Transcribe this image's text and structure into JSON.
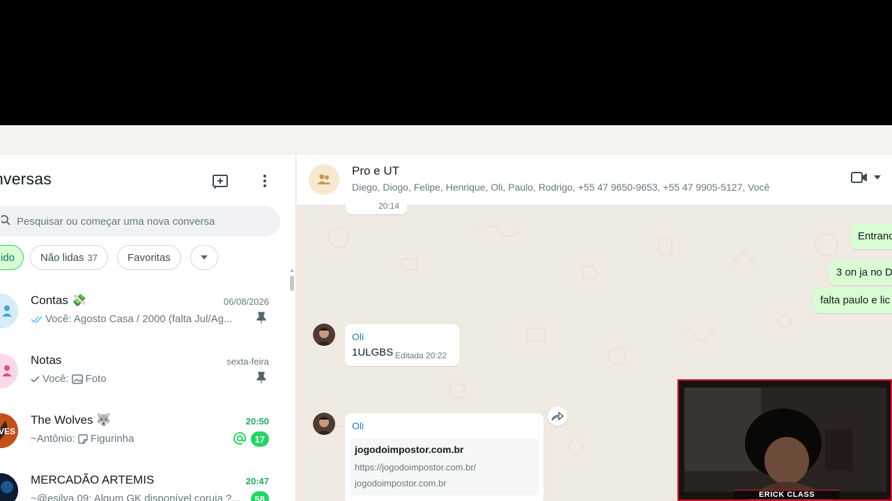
{
  "left_panel": {
    "title": "nversas",
    "search_placeholder": "Pesquisar ou começar uma nova conversa",
    "filters": [
      {
        "label": "ido",
        "active": true
      },
      {
        "label": "Não lidas",
        "count": "37"
      },
      {
        "label": "Favoritas"
      }
    ],
    "chats": [
      {
        "name": "Contas 💸",
        "time": "06/08/2026",
        "preview_prefix": "Você: Agosto Casa / 2000 (falta Jul/Ag...",
        "pinned": true,
        "time_green": false
      },
      {
        "name": "Notas",
        "time": "sexta-feira",
        "preview_prefix": "Você:",
        "preview_media": "Foto",
        "pinned": true,
        "time_green": false
      },
      {
        "name": "The Wolves 🐺",
        "time": "20:50",
        "preview_prefix": "~Antônio:",
        "preview_media": "Figurinha",
        "unread": "17",
        "mention": true,
        "time_green": true
      },
      {
        "name": "MERCADÃO ARTEMIS",
        "time": "20:47",
        "preview_prefix": "~@esilva.09: Algum GK disponível coruja ?...",
        "unread": "58",
        "time_green": true
      }
    ],
    "avatar_text": {
      "wolves": "VES"
    }
  },
  "conversation": {
    "title": "Pro e UT",
    "members": "Diego, Diogo, Felipe, Henrique, Oli, Paulo, Rodrigo, +55 47 9650-9653, +55 47 9905-5127, Você",
    "messages": [
      {
        "type": "in-partial",
        "time": "20:14"
      },
      {
        "type": "out",
        "text": "Entranc"
      },
      {
        "type": "out",
        "text": "3 on ja no D"
      },
      {
        "type": "out",
        "text": "falta paulo e lic"
      },
      {
        "type": "in",
        "sender": "Oli",
        "text": "1ULGBS",
        "time": "Editada 20:22"
      },
      {
        "type": "in-link",
        "sender": "Oli",
        "link_title": "jogodoimpostor.com.br",
        "link_url": "https://jogodoimpostor.com.br/",
        "link_domain": "jogodoimpostor.com.br"
      }
    ]
  },
  "webcam": {
    "label": "ERICK CLASS"
  },
  "colors": {
    "accent": "#25d366",
    "sender": "#1f7ab8",
    "outgoing": "#d9fdd3",
    "overlay_border": "#e5132a"
  }
}
